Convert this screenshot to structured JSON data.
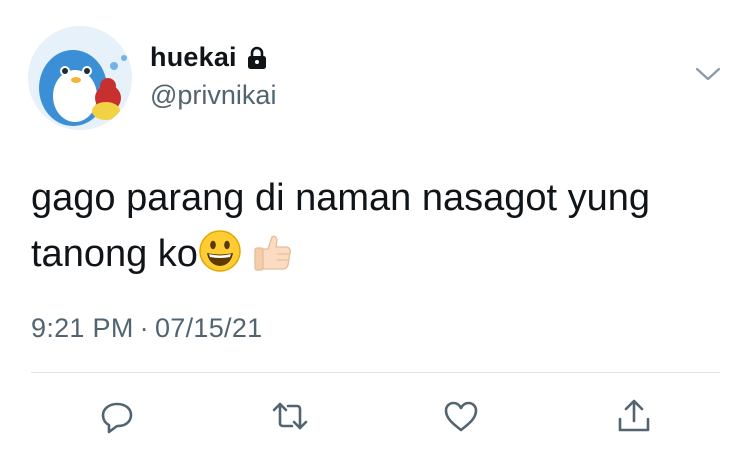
{
  "tweet": {
    "display_name": "huekai",
    "handle": "@privnikai",
    "text_line1": "gago parang di naman nasagot yung",
    "text_line2": "tanong ko",
    "time": "9:21 PM",
    "separator": "·",
    "date": "07/15/21"
  },
  "icons": {
    "lock": "lock-icon",
    "more": "chevron-down-icon",
    "smile": "grinning-face-emoji",
    "thumbs": "thumbs-up-emoji",
    "reply": "reply-icon",
    "retweet": "retweet-icon",
    "like": "heart-icon",
    "share": "share-icon"
  },
  "colors": {
    "text": "#0f1419",
    "secondary": "#536471",
    "divider": "#dfe3e6"
  }
}
